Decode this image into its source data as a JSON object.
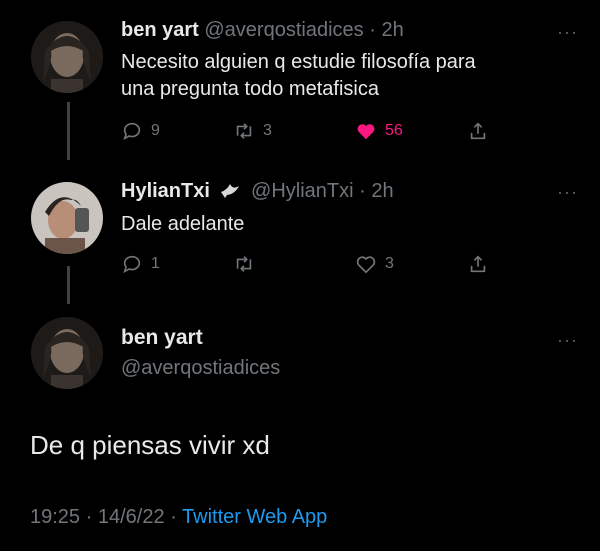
{
  "tweets": [
    {
      "name": "ben yart",
      "handle": "@averqostiadices",
      "sep": "·",
      "time": "2h",
      "text_line1": "Necesito alguien q estudie filosofía para",
      "text_line2": "una pregunta todo metafisica",
      "replies": "9",
      "retweets": "3",
      "likes": "56",
      "more": "···"
    },
    {
      "name": "HylianTxi",
      "name_badge_icon": "dove-icon",
      "handle": "@HylianTxi",
      "sep": "·",
      "time": "2h",
      "text": "Dale adelante",
      "replies": "1",
      "likes": "3",
      "more": "···"
    }
  ],
  "main_tweet": {
    "name": "ben yart",
    "handle": "@averqostiadices",
    "text": "De q piensas vivir xd",
    "time": "19:25",
    "date": "14/6/22",
    "sep": "·",
    "source": "Twitter Web App",
    "more": "···"
  },
  "colors": {
    "background": "#000000",
    "text": "#e7e9ea",
    "secondary": "#71767b",
    "like": "#f91880",
    "link": "#1d9bf0"
  }
}
